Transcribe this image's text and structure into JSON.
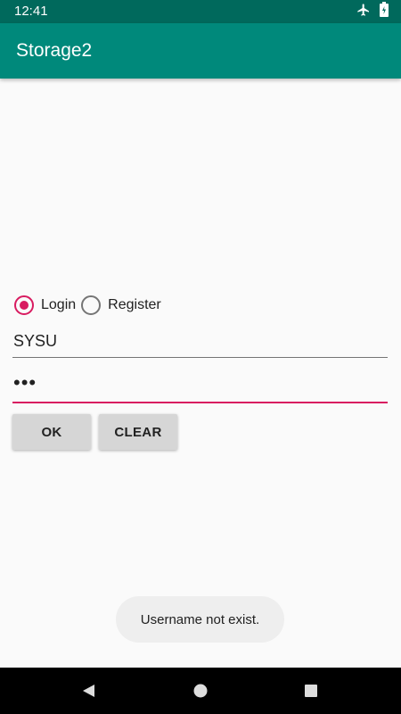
{
  "status_bar": {
    "time": "12:41",
    "icons": [
      "airplane-icon",
      "battery-icon"
    ]
  },
  "app_bar": {
    "title": "Storage2"
  },
  "mode": {
    "options": [
      {
        "label": "Login",
        "checked": true
      },
      {
        "label": "Register",
        "checked": false
      }
    ]
  },
  "form": {
    "username_value": "SYSU",
    "password_value": "•••"
  },
  "buttons": {
    "ok_label": "OK",
    "clear_label": "CLEAR"
  },
  "toast": {
    "message": "Username not exist."
  },
  "nav_bar": {
    "icons": [
      "back-icon",
      "home-icon",
      "recents-icon"
    ]
  },
  "colors": {
    "primary": "#00897b",
    "primary_dark": "#00695c",
    "accent": "#d81b60"
  }
}
